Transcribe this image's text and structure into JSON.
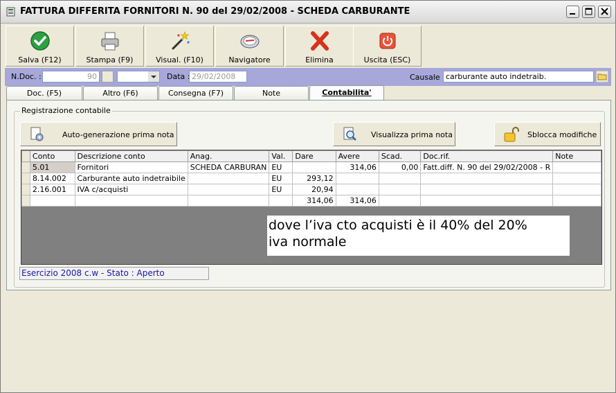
{
  "window": {
    "title": "FATTURA DIFFERITA FORNITORI N.  90  del 29/02/2008 - SCHEDA CARBURANTE",
    "controls": [
      "minimize",
      "maximize",
      "close"
    ]
  },
  "toolbar": {
    "buttons": [
      {
        "label": "Salva (F12)",
        "icon": "checkmark-icon"
      },
      {
        "label": "Stampa (F9)",
        "icon": "printer-icon"
      },
      {
        "label": "Visual. (F10)",
        "icon": "magic-wand-icon"
      },
      {
        "label": "Navigatore",
        "icon": "compass-icon"
      },
      {
        "label": "Elimina",
        "icon": "delete-x-icon"
      },
      {
        "label": "Uscita (ESC)",
        "icon": "power-icon"
      }
    ]
  },
  "header_fields": {
    "ndoc_label": "N.Doc. :",
    "ndoc_value": "90",
    "data_label": "Data :",
    "data_value": "29/02/2008",
    "causale_label": "Causale :",
    "causale_value": "carburante auto indetraib."
  },
  "tabs": [
    {
      "label": "Doc. (F5)",
      "active": false
    },
    {
      "label": "Altro (F6)",
      "active": false
    },
    {
      "label": "Consegna (F7)",
      "active": false
    },
    {
      "label": "Note",
      "active": false
    },
    {
      "label": "Contabilita'",
      "active": true
    }
  ],
  "accounting": {
    "group_title": "Registrazione contabile",
    "autogen_label": "Auto-generazione prima nota",
    "view_label": "Visualizza prima nota",
    "unlock_label": "Sblocca modifiche",
    "columns": [
      "Conto",
      "Descrizione conto",
      "Anag.",
      "Val.",
      "Dare",
      "Avere",
      "Scad.",
      "Doc.rif.",
      "Note"
    ],
    "rows": [
      [
        "5.01",
        "Fornitori",
        "SCHEDA CARBURAN",
        "EU",
        "",
        "314,06",
        "0,00",
        "Fatt.diff. N. 90 del 29/02/2008 - R",
        ""
      ],
      [
        "8.14.002",
        "Carburante auto indetraibile",
        "",
        "EU",
        "293,12",
        "",
        "",
        "",
        ""
      ],
      [
        "2.16.001",
        "IVA c/acquisti",
        "",
        "EU",
        "20,94",
        "",
        "",
        "",
        ""
      ],
      [
        "",
        "",
        "",
        "",
        "314,06",
        "314,06",
        "",
        "",
        ""
      ]
    ],
    "annotation_line1": "dove l’iva cto acquisti è il 40% del 20%",
    "annotation_line2": "iva normale"
  },
  "status": {
    "text": "Esercizio 2008 c.w - Stato : Aperto"
  },
  "colors": {
    "purple_bar": "#A7A7DA",
    "status_text": "#1818A8",
    "grid_background": "#808080"
  }
}
